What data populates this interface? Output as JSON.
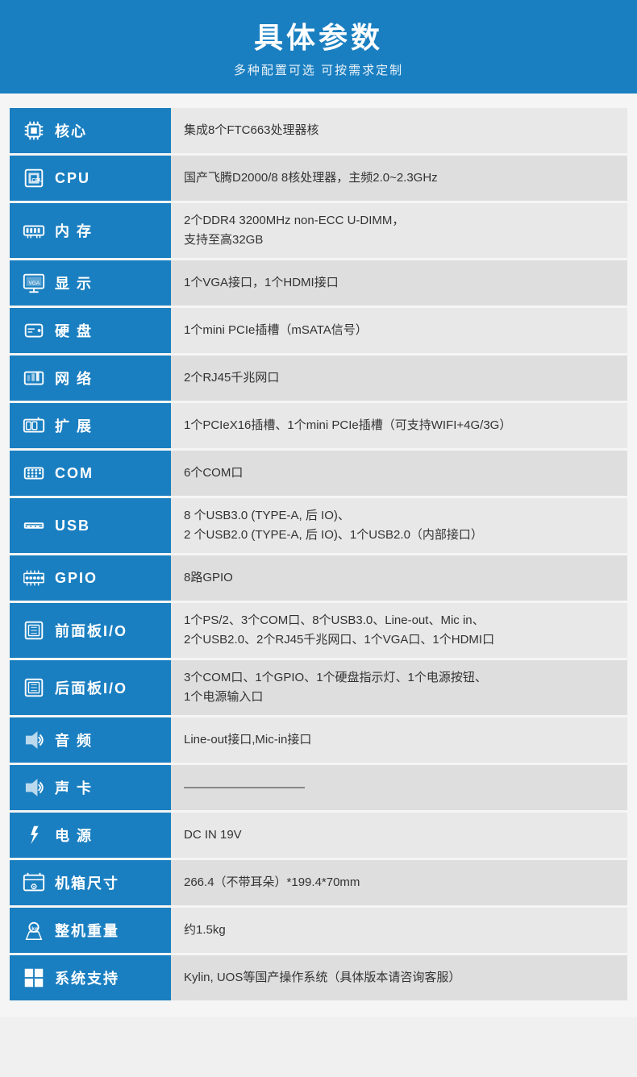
{
  "header": {
    "title": "具体参数",
    "subtitle": "多种配置可选 可按需求定制"
  },
  "specs": [
    {
      "id": "core",
      "icon_name": "cpu-chip-icon",
      "icon_unicode": "⬛",
      "label": "核心",
      "value": "集成8个FTC663处理器核"
    },
    {
      "id": "cpu",
      "icon_name": "cpu-icon",
      "icon_unicode": "⬡",
      "label": "CPU",
      "value": "国产飞腾D2000/8  8核处理器，主频2.0~2.3GHz"
    },
    {
      "id": "ram",
      "icon_name": "ram-icon",
      "icon_unicode": "▦",
      "label": "内 存",
      "value": "2个DDR4 3200MHz non-ECC U-DIMM，\n支持至高32GB"
    },
    {
      "id": "display",
      "icon_name": "display-icon",
      "icon_unicode": "⬜",
      "label": "显 示",
      "value": "1个VGA接口，1个HDMI接口"
    },
    {
      "id": "hdd",
      "icon_name": "hdd-icon",
      "icon_unicode": "◼",
      "label": "硬 盘",
      "value": "1个mini PCIe插槽（mSATA信号）"
    },
    {
      "id": "network",
      "icon_name": "network-icon",
      "icon_unicode": "⬡",
      "label": "网 络",
      "value": "2个RJ45千兆网口"
    },
    {
      "id": "expand",
      "icon_name": "expand-icon",
      "icon_unicode": "▣",
      "label": "扩 展",
      "value": "1个PCIeX16插槽、1个mini PCIe插槽（可支持WIFI+4G/3G）"
    },
    {
      "id": "com",
      "icon_name": "com-icon",
      "icon_unicode": "▤",
      "label": "COM",
      "value": "6个COM口"
    },
    {
      "id": "usb",
      "icon_name": "usb-icon",
      "icon_unicode": "⇌",
      "label": "USB",
      "value": "8 个USB3.0 (TYPE-A, 后 IO)、\n2 个USB2.0 (TYPE-A, 后 IO)、1个USB2.0（内部接口）"
    },
    {
      "id": "gpio",
      "icon_name": "gpio-icon",
      "icon_unicode": "▦",
      "label": "GPIO",
      "value": "8路GPIO"
    },
    {
      "id": "front-io",
      "icon_name": "front-panel-icon",
      "icon_unicode": "▢",
      "label": "前面板I/O",
      "value": "1个PS/2、3个COM口、8个USB3.0、Line-out、Mic in、\n2个USB2.0、2个RJ45千兆网口、1个VGA口、1个HDMI口"
    },
    {
      "id": "rear-io",
      "icon_name": "rear-panel-icon",
      "icon_unicode": "▢",
      "label": "后面板I/O",
      "value": "3个COM口、1个GPIO、1个硬盘指示灯、1个电源按钮、\n1个电源输入口"
    },
    {
      "id": "audio",
      "icon_name": "audio-icon",
      "icon_unicode": "◀",
      "label": "音 频",
      "value": "Line-out接口,Mic-in接口"
    },
    {
      "id": "sound",
      "icon_name": "sound-card-icon",
      "icon_unicode": "◀",
      "label": "声 卡",
      "value": "——————————"
    },
    {
      "id": "power",
      "icon_name": "power-icon",
      "icon_unicode": "⚡",
      "label": "电 源",
      "value": "DC IN 19V"
    },
    {
      "id": "case",
      "icon_name": "case-size-icon",
      "icon_unicode": "✦",
      "label": "机箱尺寸",
      "value": "266.4（不带耳朵）*199.4*70mm"
    },
    {
      "id": "weight",
      "icon_name": "weight-icon",
      "icon_unicode": "⬤",
      "label": "整机重量",
      "value": "约1.5kg"
    },
    {
      "id": "os",
      "icon_name": "os-icon",
      "icon_unicode": "⊞",
      "label": "系统支持",
      "value": "Kylin, UOS等国产操作系统（具体版本请咨询客服）"
    }
  ]
}
